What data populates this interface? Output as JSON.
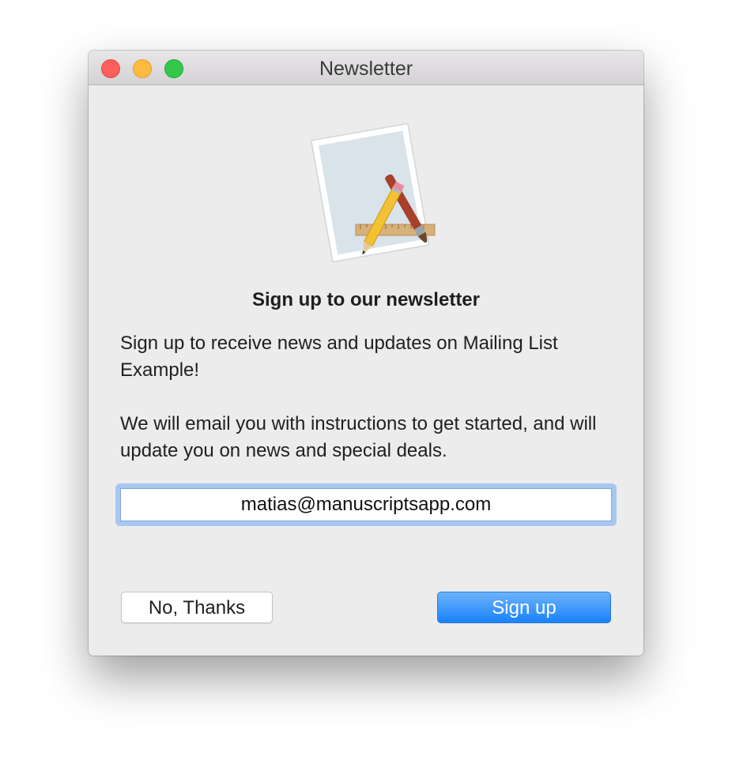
{
  "window": {
    "title": "Newsletter",
    "traffic_lights": [
      "close",
      "minimize",
      "zoom"
    ]
  },
  "icon": {
    "name": "app-icon-paper-ruler-pencil-brush"
  },
  "content": {
    "heading": "Sign up to our newsletter",
    "paragraph1": "Sign up to receive news and updates on Mailing List Example!",
    "paragraph2": "We will email you with instructions to get started, and will update you on news and special deals."
  },
  "email": {
    "value": "matias@manuscriptsapp.com",
    "placeholder": ""
  },
  "buttons": {
    "decline_label": "No, Thanks",
    "signup_label": "Sign up"
  },
  "colors": {
    "accent": "#1a82fb",
    "focus_ring": "#a8c7ee",
    "window_bg": "#ececec"
  }
}
